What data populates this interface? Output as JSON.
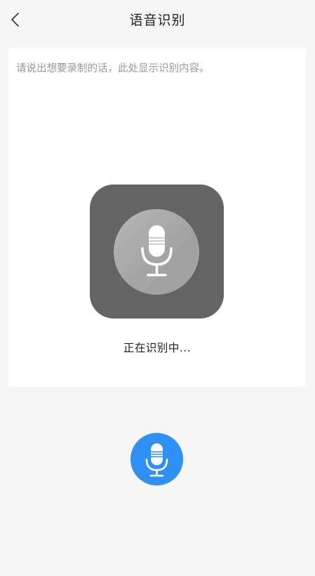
{
  "header": {
    "title": "语音识别",
    "back_icon": "chevron-left-icon"
  },
  "card": {
    "prompt": "请说出想要录制的话，此处显示识别内容。",
    "status": "正在识别中...",
    "mic_icon": "microphone-icon"
  },
  "record": {
    "icon": "microphone-icon",
    "color": "#2f91f5"
  },
  "colors": {
    "background": "#f7f7f7",
    "card": "#ffffff",
    "mic_tile": "#646464",
    "prompt_text": "#9a9a9a"
  }
}
